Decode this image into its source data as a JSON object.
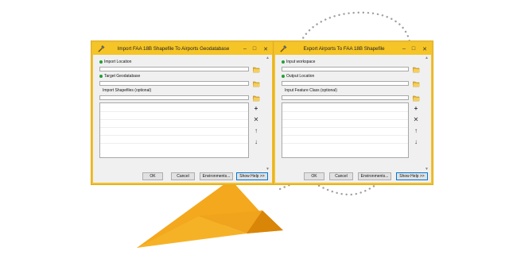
{
  "dialogs": {
    "import": {
      "title": "Import FAA 18B Shapefile To Airports Geodatabase",
      "fields": [
        {
          "label": "Import Location",
          "required": true
        },
        {
          "label": "Target Geodatabase",
          "required": true
        },
        {
          "label": "Import Shapefiles (optional)",
          "required": false
        }
      ],
      "buttons": {
        "ok": "OK",
        "cancel": "Cancel",
        "environments": "Environments...",
        "help": "Show Help >>"
      }
    },
    "export": {
      "title": "Export Airports To FAA 18B Shapefile",
      "fields": [
        {
          "label": "Input workspace",
          "required": true
        },
        {
          "label": "Output Location",
          "required": true
        },
        {
          "label": "Input Feature Class (optional)",
          "required": false
        }
      ],
      "buttons": {
        "ok": "OK",
        "cancel": "Cancel",
        "environments": "Environments...",
        "help": "Show Help >>"
      }
    }
  },
  "list_controls": [
    "add-icon",
    "remove-icon",
    "move-up-icon",
    "move-down-icon"
  ],
  "window_controls": [
    "minimize-icon",
    "maximize-icon",
    "close-icon"
  ],
  "colors": {
    "accent_border": "#f2c12e",
    "titlebar": "#f5c427",
    "paper_plane": "#f0a31c",
    "required_dot": "#21a035",
    "flight_path": "#a0a0a0"
  }
}
